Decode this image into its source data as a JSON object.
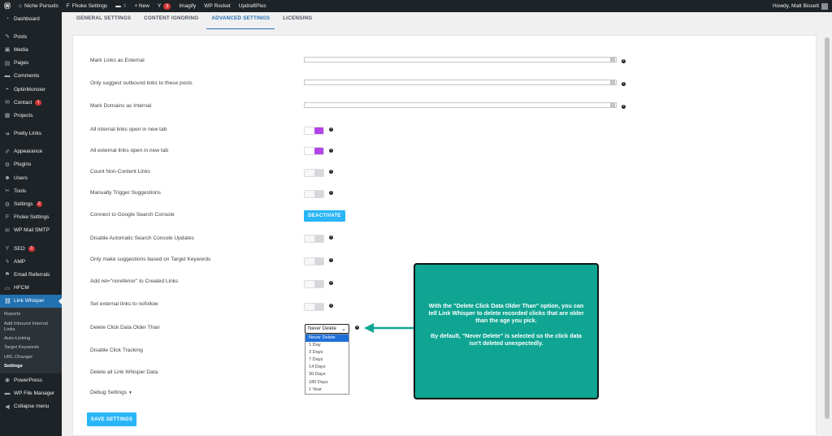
{
  "admin_bar": {
    "site_name": "Niche Pursuits",
    "fhoke": "Fhoke Settings",
    "comments_count": "0",
    "new_label": "+ New",
    "updates_count": "3",
    "imagify": "Imagify",
    "wp_rocket": "WP Rocket",
    "updraft": "UpdraftPlus",
    "greeting": "Howdy, Matt Bissett"
  },
  "sidebar": {
    "items": [
      {
        "label": "Dashboard",
        "icon": "dashboard-icon",
        "glyph": "◔"
      },
      {
        "label": "Posts",
        "icon": "pin-icon",
        "glyph": "✎"
      },
      {
        "label": "Media",
        "icon": "media-icon",
        "glyph": "▣"
      },
      {
        "label": "Pages",
        "icon": "page-icon",
        "glyph": "▤"
      },
      {
        "label": "Comments",
        "icon": "comment-icon",
        "glyph": "▬"
      },
      {
        "label": "OptinMonster",
        "icon": "monster-icon",
        "glyph": "◓"
      },
      {
        "label": "Contact",
        "icon": "mail-icon",
        "glyph": "✉",
        "badge": "1"
      },
      {
        "label": "Projects",
        "icon": "portfolio-icon",
        "glyph": "▦"
      },
      {
        "label": "Pretty Links",
        "icon": "link-icon",
        "glyph": "➜"
      },
      {
        "label": "Appearance",
        "icon": "brush-icon",
        "glyph": "✐"
      },
      {
        "label": "Plugins",
        "icon": "plugin-icon",
        "glyph": "⚙"
      },
      {
        "label": "Users",
        "icon": "users-icon",
        "glyph": "☻"
      },
      {
        "label": "Tools",
        "icon": "tools-icon",
        "glyph": "✂"
      },
      {
        "label": "Settings",
        "icon": "settings-icon",
        "glyph": "⚙",
        "badge": "2"
      },
      {
        "label": "Fhoke Settings",
        "icon": "fhoke-icon",
        "glyph": "F"
      },
      {
        "label": "WP Mail SMTP",
        "icon": "smtp-icon",
        "glyph": "✉"
      },
      {
        "label": "SEO",
        "icon": "yoast-icon",
        "glyph": "Y",
        "badge": "3"
      },
      {
        "label": "AMP",
        "icon": "amp-icon",
        "glyph": "ϟ"
      },
      {
        "label": "Email Referrals",
        "icon": "network-icon",
        "glyph": "⚑"
      },
      {
        "label": "HFCM",
        "icon": "code-icon",
        "glyph": "▭"
      },
      {
        "label": "Link Whisper",
        "icon": "link-whisper-icon",
        "glyph": "⛓"
      }
    ],
    "submenu": [
      "Reports",
      "Add Inbound Internal Links",
      "Auto-Linking",
      "Target Keywords",
      "URL Changer",
      "Settings"
    ],
    "after": [
      {
        "label": "PowerPress",
        "icon": "podcast-icon",
        "glyph": "◉"
      },
      {
        "label": "WP File Manager",
        "icon": "folder-icon",
        "glyph": "▬"
      },
      {
        "label": "Collapse menu",
        "icon": "collapse-icon",
        "glyph": "◀"
      }
    ]
  },
  "tabs": [
    "GENERAL SETTINGS",
    "CONTENT IGNORING",
    "ADVANCED SETTINGS",
    "LICENSING"
  ],
  "settings": {
    "mark_external": "Mark Links as External",
    "only_suggest_outbound": "Only suggest outbound links to these posts",
    "mark_domains_internal": "Mark Domains as Internal",
    "internal_new_tab": "All internal links open in new tab",
    "external_new_tab": "All external links open in new tab",
    "count_non_content": "Count Non-Content Links",
    "manual_trigger": "Manually Trigger Suggestions",
    "connect_gsc": "Connect to Google Search Console",
    "disable_gsc_updates": "Disable Automatic Search Console Updates",
    "target_keywords_only": "Only make suggestions based on Target Keywords",
    "noreferrer": "Add rel=\"noreferrer\" to Created Links",
    "nofollow": "Set external links to nofollow",
    "delete_click_data": "Delete Click Data Older Than",
    "disable_click_tracking": "Disable Click Tracking",
    "delete_all_data": "Delete all Link Whisper Data",
    "debug_settings": "Debug Settings",
    "debug_caret": "▼",
    "deactivate_label": "DEACTIVATE",
    "save_label": "SAVE SETTINGS",
    "help_glyph": "?",
    "toggles": {
      "internal_new_tab": true,
      "external_new_tab": true,
      "count_non_content": false,
      "manual_trigger": false,
      "disable_gsc_updates": false,
      "target_keywords_only": false,
      "noreferrer": false,
      "nofollow": false
    }
  },
  "select": {
    "selected": "Never Delete",
    "chevron": "⌄",
    "options": [
      "Never Delete",
      "1 Day",
      "3 Days",
      "7 Days",
      "14 Days",
      "30 Days",
      "180 Days",
      "1 Year"
    ]
  },
  "callout": {
    "paragraph1": "With the \"Delete Click Data Older Than\" option, you can tell Link Whisper to delete recorded clicks that are older than the age you pick.",
    "paragraph2": "By default, \"Never Delete\" is selected so the click data isn't deleted unexpectedly."
  },
  "colors": {
    "toggle_on": "#b344e8",
    "accent_blue": "#29b5f6",
    "callout_bg": "#0fa592",
    "arrow": "#0fa592",
    "admin_dark": "#1d2327",
    "active_menu": "#2271b1"
  }
}
